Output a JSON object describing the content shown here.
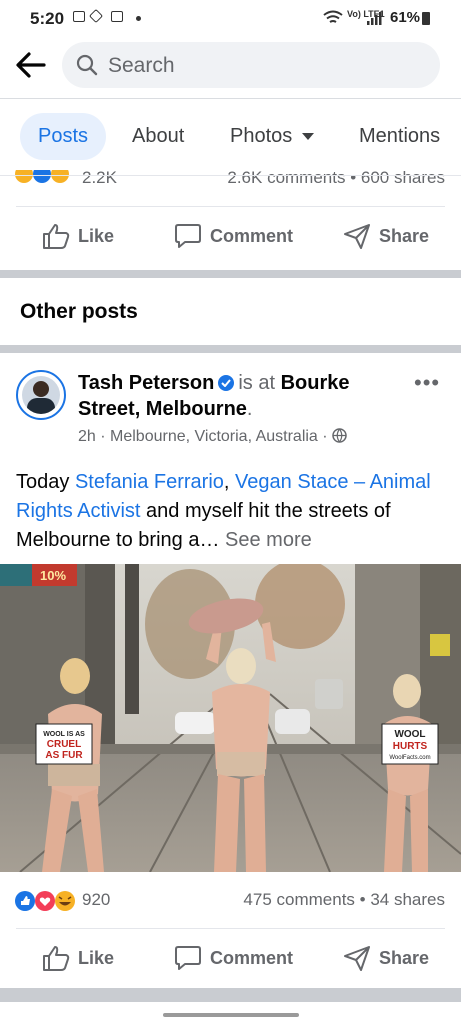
{
  "status_bar": {
    "time": "5:20",
    "battery": "61%",
    "network": "Vo) LTE1"
  },
  "search": {
    "placeholder": "Search"
  },
  "tabs": [
    {
      "label": "Posts",
      "active": true
    },
    {
      "label": "About"
    },
    {
      "label": "Photos",
      "has_dropdown": true
    },
    {
      "label": "Mentions"
    }
  ],
  "prev_post": {
    "reaction_count": "2.2K",
    "comments_shares": "2.6K comments • 600 shares"
  },
  "actions": {
    "like": "Like",
    "comment": "Comment",
    "share": "Share"
  },
  "section_title": "Other posts",
  "post": {
    "author": "Tash Peterson",
    "is_at": "is at",
    "location": "Bourke Street, Melbourne",
    "time": "2h",
    "place": "Melbourne, Victoria, Australia",
    "text_intro": "Today ",
    "mention1": "Stefania Ferrario",
    "comma": ", ",
    "mention2": "Vegan Stace – Animal Rights Activist",
    "text_rest": " and myself hit the streets of Melbourne to bring a…",
    "see_more": "See more",
    "reaction_count": "920",
    "comments": "475 comments",
    "shares": "34 shares",
    "sign_left": [
      "WOOL IS AS",
      "CRUEL",
      "AS FUR"
    ],
    "sign_right": [
      "WOOL",
      "HURTS",
      "WoolFacts.com"
    ],
    "store_sign": "10%"
  },
  "colors": {
    "brand_blue": "#1b74e4",
    "muted": "#65676b",
    "separator": "#c9ccd1"
  },
  "icons": [
    "back-arrow-icon",
    "search-icon",
    "like-icon",
    "comment-icon",
    "share-icon",
    "verified-icon",
    "globe-icon",
    "more-icon"
  ]
}
